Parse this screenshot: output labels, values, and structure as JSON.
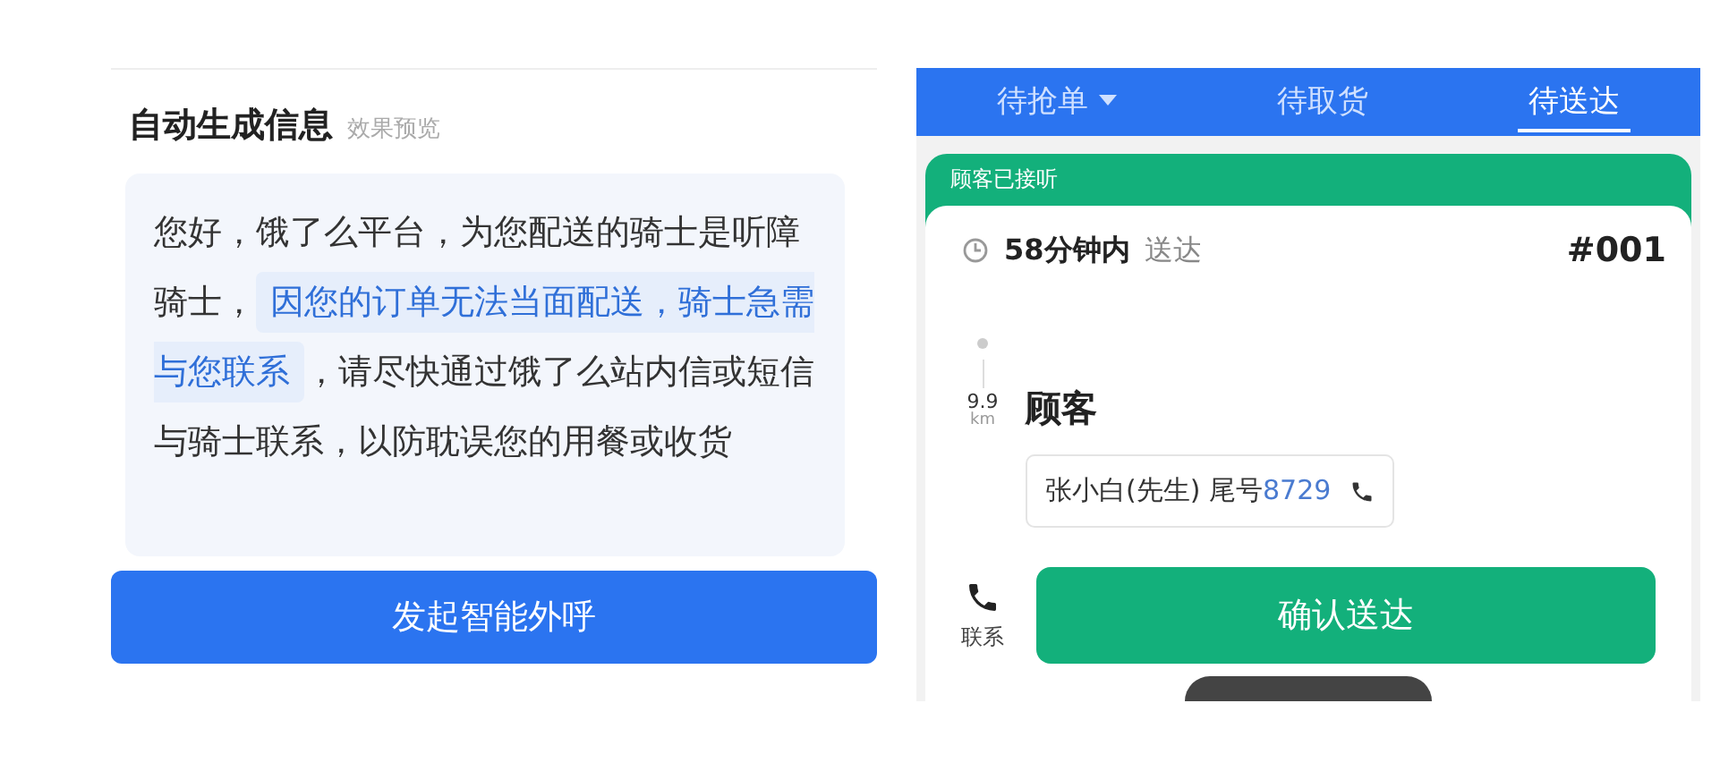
{
  "message_panel": {
    "title": "自动生成信息",
    "subtitle": "效果预览",
    "message": [
      {
        "text": "您好，饿了么平台，为您配送的骑士是听障骑士，",
        "highlighted": false
      },
      {
        "text": "因您的订单无法当面配送，骑士急需与您联系",
        "highlighted": true
      },
      {
        "text": "，请尽快通过饿了么站内信或短信与骑士联系，以防耽误您的用餐或收货",
        "highlighted": false
      }
    ],
    "button": "发起智能外呼"
  },
  "order_app": {
    "tabs": [
      {
        "label": "待抢单",
        "selected": false,
        "dropdown": true
      },
      {
        "label": "待取货",
        "selected": false,
        "dropdown": false
      },
      {
        "label": "待送达",
        "selected": true,
        "dropdown": false
      }
    ],
    "status_banner": "顾客已接听",
    "order": {
      "time": "58分钟内",
      "time_suffix": "送达",
      "number": "#001",
      "distance": "9.9",
      "distance_unit": "km",
      "recipient_label": "顾客",
      "customer_name": "张小白(先生)",
      "tail_label": "尾号",
      "tail_number": "8729"
    },
    "contact_label": "联系",
    "confirm_button": "确认送达"
  }
}
